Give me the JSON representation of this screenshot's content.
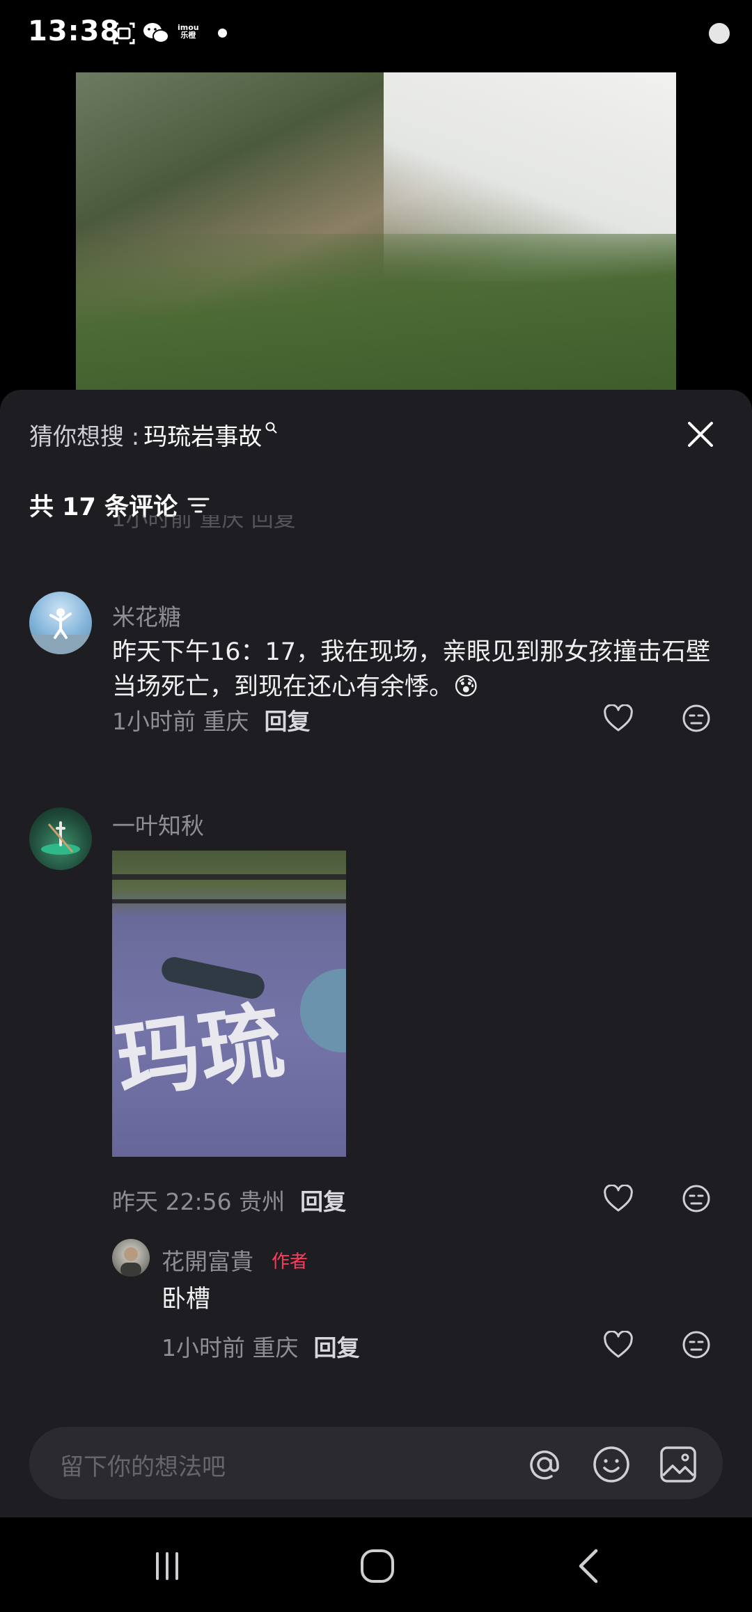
{
  "status_bar": {
    "time": "13:38",
    "brand_text_top": "imou",
    "brand_text_bottom": "乐橙",
    "icons": [
      "screen-capture-icon",
      "wechat-icon",
      "imou-icon",
      "notification-dot-icon",
      "battery-icon"
    ]
  },
  "sheet": {
    "search_prefix": "猜你想搜 :",
    "search_term": "玛琉岩事故",
    "comment_count_label": "共 17 条评论",
    "partial_meta": "1小时前 重庆 回复"
  },
  "comments": [
    {
      "name": "米花糖",
      "text": "昨天下午16：17，我在现场，亲眼见到那女孩撞击石壁当场死亡，到现在还心有余悸。",
      "emoji": "😰",
      "time_location": "1小时前 重庆",
      "reply_label": "回复"
    },
    {
      "name": "一叶知秋",
      "image_text": "玛琉",
      "time_location": "昨天 22:56 贵州",
      "reply_label": "回复"
    }
  ],
  "reply": {
    "name": "花開富貴",
    "badge": "作者",
    "text": "卧槽",
    "time_location": "1小时前 重庆",
    "reply_label": "回复"
  },
  "input": {
    "placeholder": "留下你的想法吧",
    "icons": [
      "at-icon",
      "emoji-icon",
      "image-icon"
    ]
  },
  "nav": {
    "icons": [
      "recent-apps-icon",
      "home-icon",
      "back-icon"
    ]
  },
  "colors": {
    "sheet_bg": "#1d1d22",
    "author_badge": "#ff3b5c",
    "meta_text": "#8e8e94"
  }
}
